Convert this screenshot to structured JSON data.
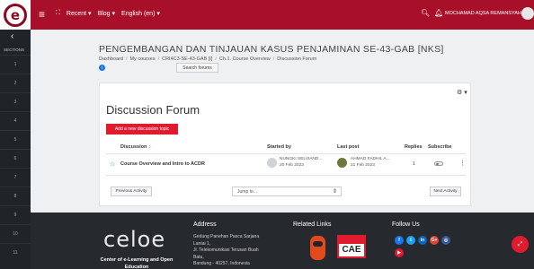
{
  "topbar": {
    "brand_letter": "e",
    "nav": [
      "Recent",
      "Blog",
      "English (en)"
    ],
    "user_name": "MOCHAMAD AQSA REMANSYAH"
  },
  "sidebar": {
    "label": "SECTIONS",
    "items": [
      "1",
      "2",
      "3",
      "4",
      "5",
      "6",
      "7",
      "8",
      "9",
      "10",
      "11"
    ]
  },
  "header": {
    "course_title": "PENGEMBANGAN DAN TINJAUAN KASUS PENJAMINAN SE-43-GAB [NKS]",
    "breadcrumb": [
      "Dashboard",
      "My courses",
      "CRI4C3-SE-43-GAB [I]",
      "Ch.1. Course Overview",
      "Discussion Forum"
    ],
    "search_forums": "Search forums"
  },
  "forum": {
    "title": "Discussion Forum",
    "add_topic": "Add a new discussion topic",
    "columns": {
      "discussion": "Discussion",
      "started_by": "Started by",
      "last_post": "Last post",
      "replies": "Replies",
      "subscribe": "Subscribe"
    },
    "rows": [
      {
        "name": "Course Overview and Intro to ACDR",
        "starter": "NUNGKI SELVIAND...",
        "start_date": "20 Feb 2023",
        "last_poster": "AHMAD FADHIL A...",
        "last_date": "21 Feb 2023",
        "replies": "1"
      }
    ],
    "prev": "Previous Activity",
    "jump": "Jump to...",
    "next": "Next Activity"
  },
  "footer": {
    "logo_text": "celoe",
    "tagline": "Center of e-Learning and Open Education",
    "address_title": "Address",
    "address_lines": [
      "Gedung Panehan Pasca Sarjana",
      "Lantai 1,",
      "Jl. Telekomunikasi Terusan Buah",
      "Batu,",
      "Bandung - 40257, Indonesia"
    ],
    "links_title": "Related Links",
    "cae_text": "CAE",
    "follow_title": "Follow Us",
    "social": [
      {
        "name": "facebook-icon",
        "glyph": "f",
        "color": "#1877f2"
      },
      {
        "name": "twitter-icon",
        "glyph": "t",
        "color": "#1da1f2"
      },
      {
        "name": "linkedin-icon",
        "glyph": "in",
        "color": "#0a66c2"
      },
      {
        "name": "google-plus-icon",
        "glyph": "G+",
        "color": "#db4437"
      },
      {
        "name": "instagram-icon",
        "glyph": "◎",
        "color": "#3b5998"
      },
      {
        "name": "youtube-icon",
        "glyph": "▶",
        "color": "#e01b2f"
      }
    ]
  },
  "colors": {
    "topbar": "#a8102a",
    "primary_button": "#e01b2f",
    "footer": "#26292d"
  }
}
